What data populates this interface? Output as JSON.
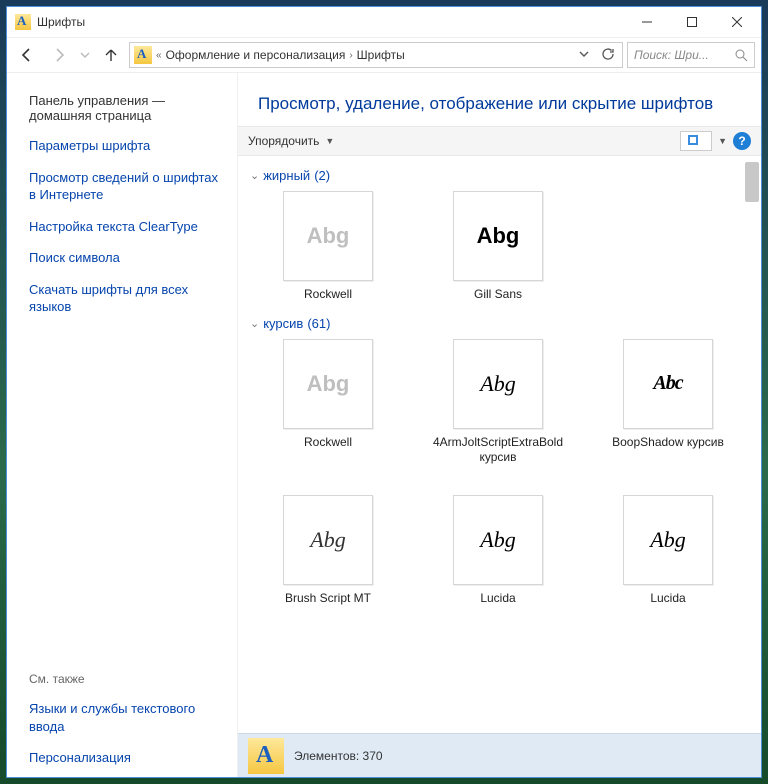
{
  "window": {
    "title": "Шрифты"
  },
  "nav": {
    "breadcrumb1": "Оформление и персонализация",
    "breadcrumb2": "Шрифты",
    "search_placeholder": "Поиск: Шри..."
  },
  "sidebar": {
    "home": "Панель управления — домашняя страница",
    "links": [
      "Параметры шрифта",
      "Просмотр сведений о шрифтах в Интернете",
      "Настройка текста ClearType",
      "Поиск символа",
      "Скачать шрифты для всех языков"
    ],
    "see_also_label": "См. также",
    "see_also": [
      "Языки и службы текстового ввода",
      "Персонализация"
    ]
  },
  "main": {
    "heading": "Просмотр, удаление, отображение или скрытие шрифтов",
    "toolbar": {
      "organize": "Упорядочить"
    },
    "groups": [
      {
        "label": "жирный",
        "count": "(2)",
        "items": [
          {
            "name": "Rockwell",
            "stack": true,
            "style": "abg-gray",
            "text": "Abg"
          },
          {
            "name": "Gill Sans",
            "stack": true,
            "style": "abg-black",
            "text": "Abg"
          }
        ]
      },
      {
        "label": "курсив",
        "count": "(61)",
        "items": [
          {
            "name": "Rockwell",
            "stack": true,
            "style": "abg-gray",
            "text": "Abg"
          },
          {
            "name": "4ArmJoltScriptExtraBold курсив",
            "stack": false,
            "style": "abg-script",
            "text": "Abg"
          },
          {
            "name": "BoopShadow курсив",
            "stack": false,
            "style": "abg-boop",
            "text": "Abc"
          },
          {
            "name": "Brush Script MT",
            "stack": false,
            "style": "abg-brush",
            "text": "Abg"
          },
          {
            "name": "Lucida",
            "stack": false,
            "style": "abg-cursive",
            "text": "Abg"
          },
          {
            "name": "Lucida",
            "stack": false,
            "style": "abg-cursive",
            "text": "Abg"
          }
        ]
      }
    ],
    "status": {
      "label": "Элементов:",
      "count": "370"
    }
  }
}
